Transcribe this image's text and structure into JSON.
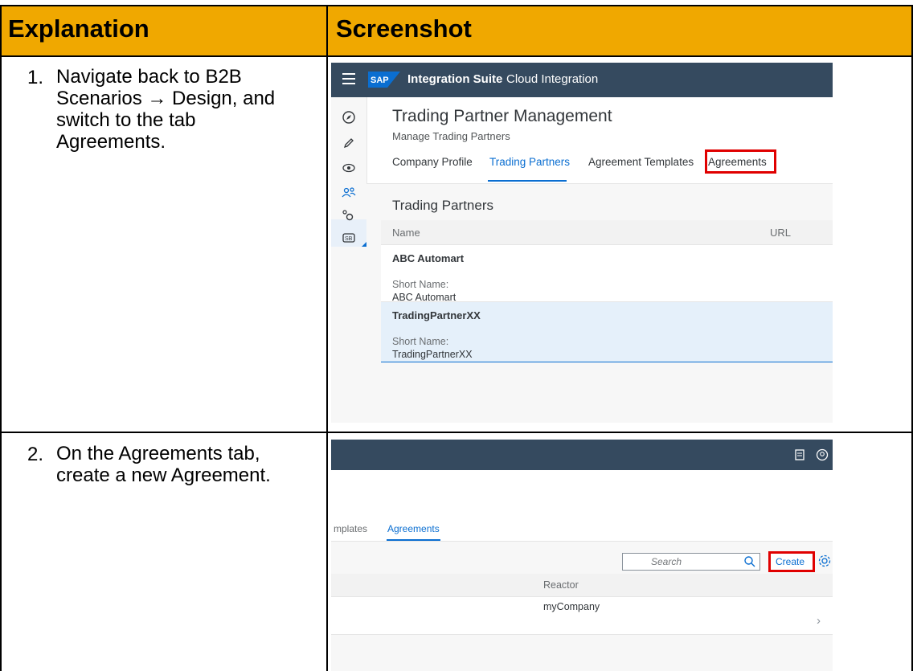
{
  "table": {
    "headers": [
      "Explanation",
      "Screenshot"
    ],
    "rows": [
      {
        "number": "1.",
        "lines": [
          "Navigate back to B2B",
          "Scenarios → Design, and",
          "switch to the tab",
          "Agreements."
        ]
      },
      {
        "number": "2.",
        "lines": [
          "On the Agreements tab,",
          "create a new Agreement."
        ]
      }
    ]
  },
  "shot1": {
    "shell": {
      "logo": "SAP",
      "product": "Integration Suite",
      "subtitle": "Cloud Integration"
    },
    "nav_icons": [
      "discover-icon",
      "design-icon",
      "monitor-icon",
      "partners-icon",
      "settings-icon",
      "b2b-icon"
    ],
    "title": "Trading Partner Management",
    "subtitle": "Manage Trading Partners",
    "tabs": [
      {
        "label": "Company Profile",
        "selected": false
      },
      {
        "label": "Trading Partners",
        "selected": true
      },
      {
        "label": "Agreement Templates",
        "selected": false
      },
      {
        "label": "Agreements",
        "selected": false,
        "highlighted": true
      }
    ],
    "section_title": "Trading Partners",
    "columns": [
      "Name",
      "URL"
    ],
    "rows": [
      {
        "name": "ABC Automart",
        "short_label": "Short Name:",
        "short_value": "ABC Automart",
        "selected": false
      },
      {
        "name": "TradingPartnerXX",
        "short_label": "Short Name:",
        "short_value": "TradingPartnerXX",
        "selected": true
      }
    ],
    "colors": {
      "shell": "#354a5f",
      "accent": "#0a6ed1",
      "highlight": "#e00000"
    }
  },
  "shot2": {
    "tabs": [
      {
        "label": "mplates",
        "selected": false
      },
      {
        "label": "Agreements",
        "selected": true
      }
    ],
    "search_placeholder": "Search",
    "create_label": "Create",
    "column": "Reactor",
    "row_value": "myCompany",
    "shell_icons": [
      "notifications-icon",
      "user-icon"
    ]
  }
}
